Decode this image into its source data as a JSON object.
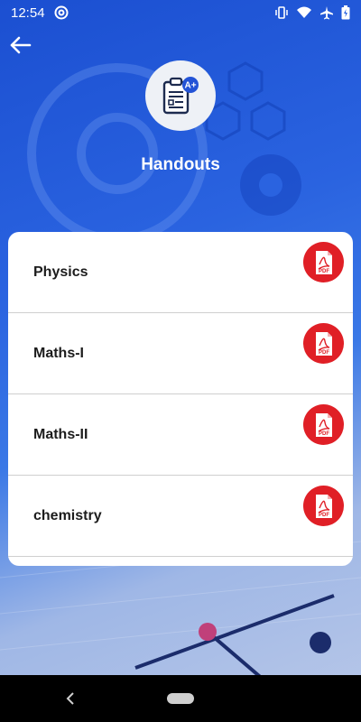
{
  "status_bar": {
    "time": "12:54",
    "icons": [
      "at-sign-icon",
      "vibrate-icon",
      "wifi-icon",
      "airplane-icon",
      "battery-icon"
    ]
  },
  "header": {
    "title": "Handouts",
    "back_icon": "arrow-left-icon",
    "logo_icon": "handout-document-icon",
    "logo_badge": "A+"
  },
  "handouts": [
    {
      "label": "Physics",
      "icon": "pdf-icon",
      "icon_text": "PDF"
    },
    {
      "label": "Maths-I",
      "icon": "pdf-icon",
      "icon_text": "PDF"
    },
    {
      "label": "Maths-II",
      "icon": "pdf-icon",
      "icon_text": "PDF"
    },
    {
      "label": "chemistry",
      "icon": "pdf-icon",
      "icon_text": "PDF"
    }
  ],
  "navigation_bar": {
    "back_icon": "chevron-left-icon",
    "home_icon": "home-pill-icon"
  },
  "colors": {
    "pdf_red": "#e01f26",
    "title_white": "#ffffff",
    "background_blue": "#2a63e0"
  }
}
